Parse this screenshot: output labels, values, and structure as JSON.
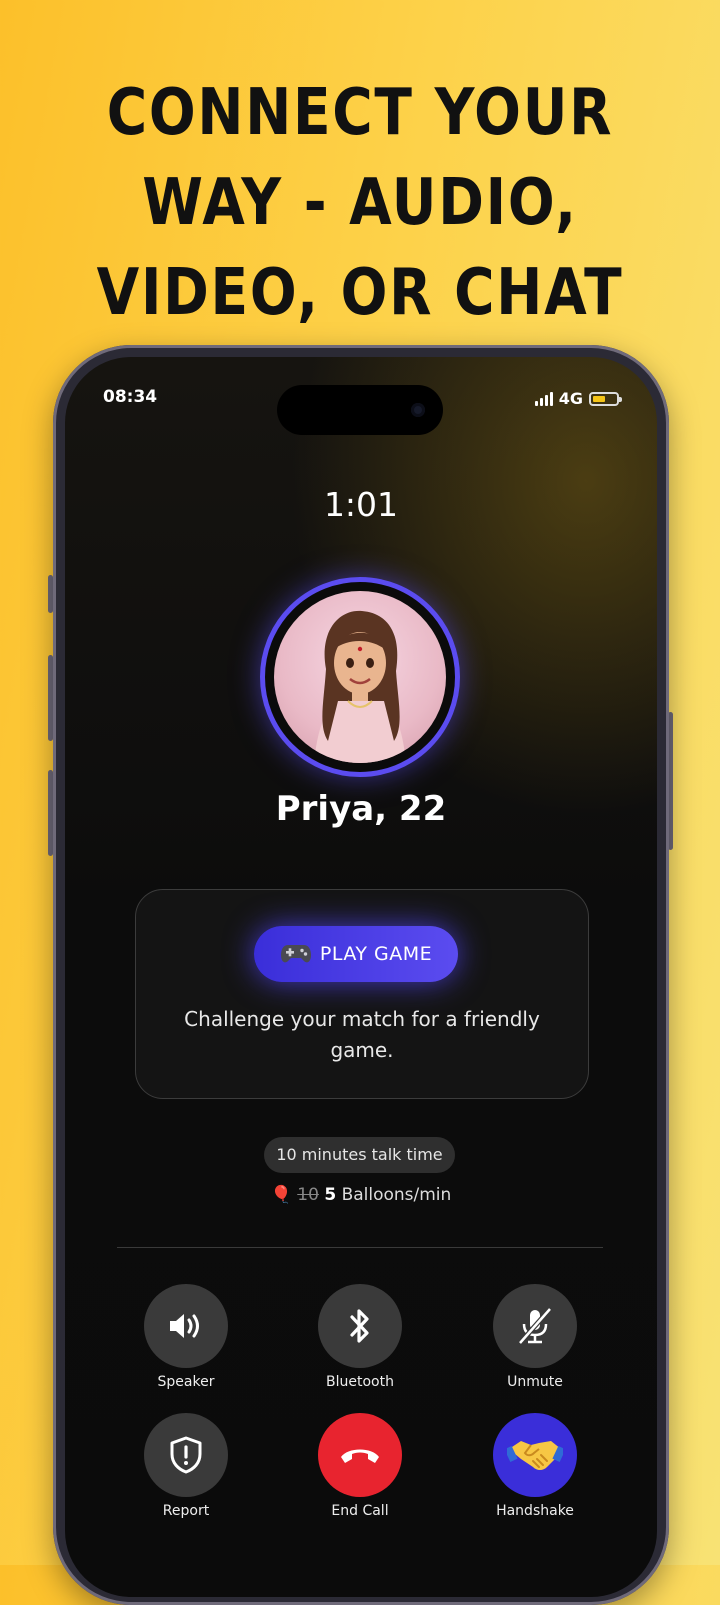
{
  "headline": "Connect your way - Audio, Video, or Chat",
  "status_bar": {
    "time": "08:34",
    "network": "4G"
  },
  "call": {
    "timer": "1:01",
    "name": "Priya, 22",
    "game": {
      "button_label": "PLAY GAME",
      "description": "Challenge your match for a friendly game."
    },
    "talk_time": "10 minutes talk time",
    "pricing": {
      "old_price": "10",
      "new_price": "5",
      "unit": "Balloons/min"
    }
  },
  "controls": [
    {
      "label": "Speaker",
      "icon": "speaker-icon"
    },
    {
      "label": "Bluetooth",
      "icon": "bluetooth-icon"
    },
    {
      "label": "Unmute",
      "icon": "mic-off-icon"
    },
    {
      "label": "Report",
      "icon": "shield-alert-icon"
    },
    {
      "label": "End Call",
      "icon": "phone-hangup-icon"
    },
    {
      "label": "Handshake",
      "icon": "handshake-icon"
    }
  ],
  "colors": {
    "accent": "#5b4cf0",
    "end_call": "#e8242f",
    "background": "#fcc02a"
  }
}
